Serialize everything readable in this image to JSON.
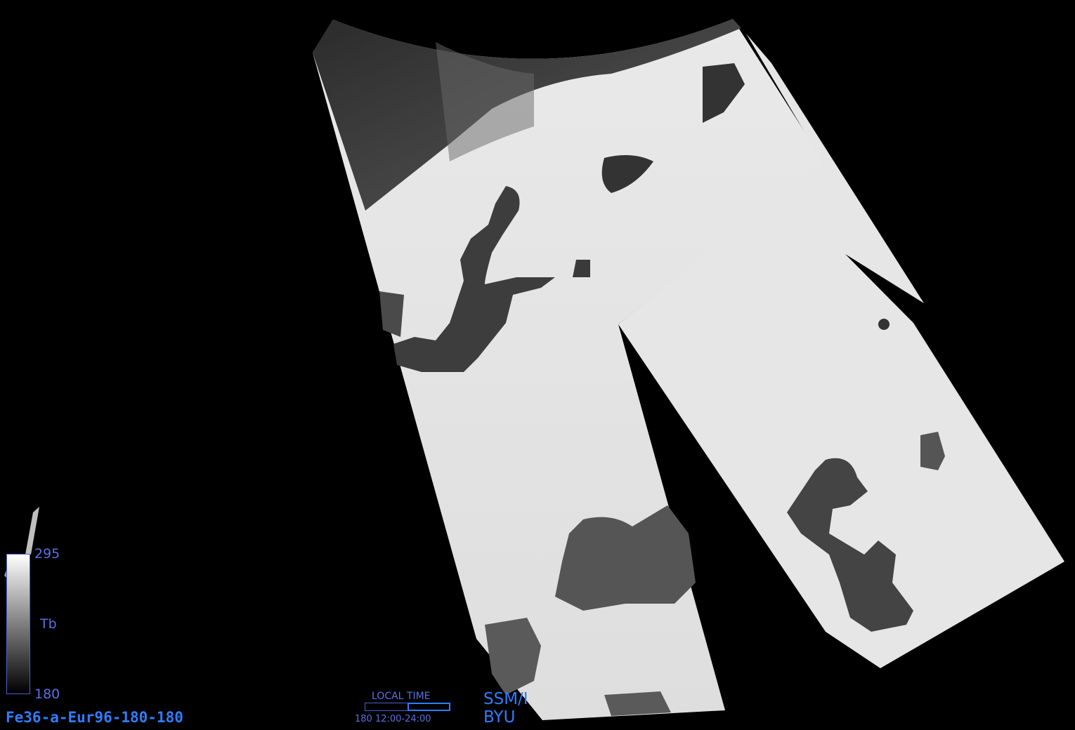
{
  "image": {
    "product_id": "Fe36-a-Eur96-180-180",
    "sensor": "SSM/I",
    "institution": "BYU",
    "colorbar": {
      "max_label": "295",
      "min_label": "180",
      "variable_label": "Tb",
      "min": 180,
      "max": 295,
      "gradient": [
        "#000000",
        "#ffffff"
      ]
    },
    "local_time": {
      "title": "LOCAL TIME",
      "scale_text": "180 12:00-24:00",
      "window_start_fraction": 0.5,
      "window_end_fraction": 1.0,
      "color": "#2f7dff"
    }
  }
}
